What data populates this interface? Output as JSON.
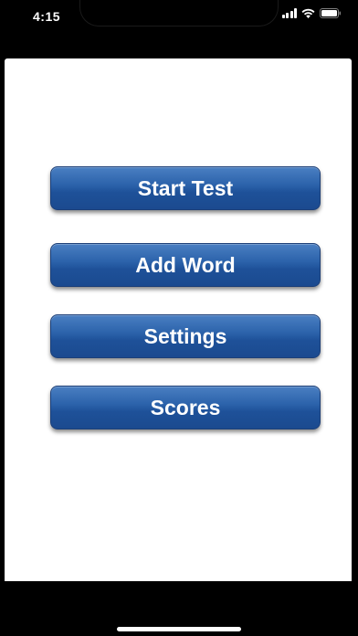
{
  "status_bar": {
    "time": "4:15",
    "icons": [
      "signal-icon",
      "wifi-icon",
      "battery-icon"
    ]
  },
  "menu": {
    "buttons": [
      {
        "label": "Start Test"
      },
      {
        "label": "Add Word"
      },
      {
        "label": "Settings"
      },
      {
        "label": "Scores"
      }
    ]
  },
  "colors": {
    "button_top": "#4a7fc2",
    "button_bottom": "#1b4a8f",
    "button_text": "#ffffff",
    "background": "#ffffff",
    "frame": "#000000"
  }
}
